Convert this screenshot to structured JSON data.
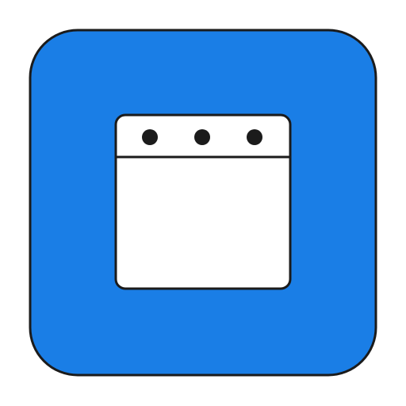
{
  "app_icon": {
    "name": "browser-window",
    "icon": "browser-window-icon",
    "window_control_dots": 3,
    "colors": {
      "tile_fill": "#1a7ee6",
      "outline": "#1b1b1b",
      "window_fill": "#ffffff",
      "page_background": "#ffffff"
    }
  }
}
